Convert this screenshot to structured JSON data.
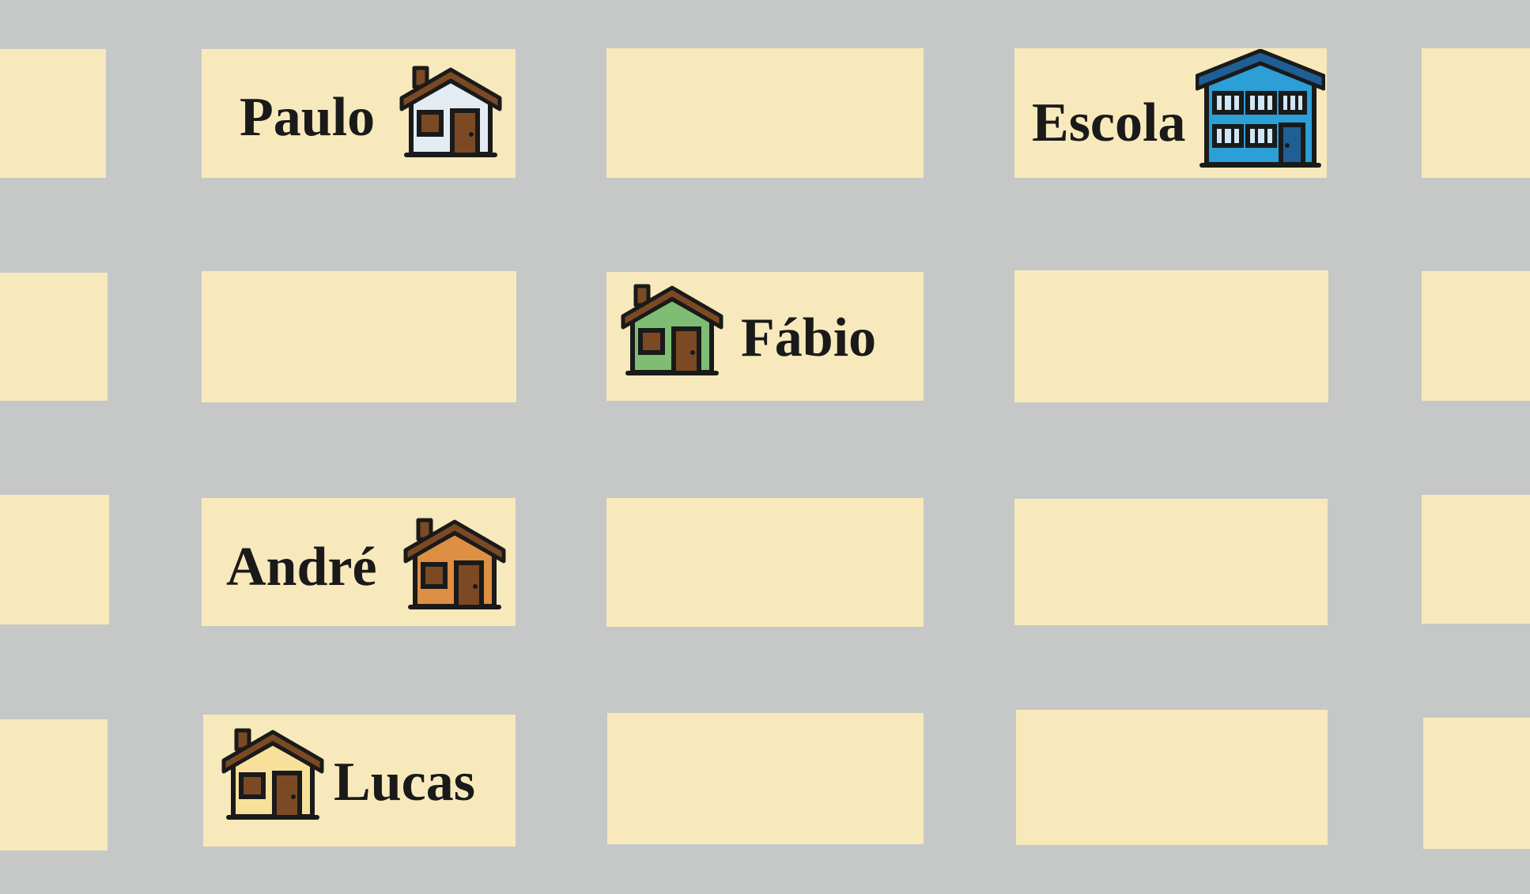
{
  "colors": {
    "street": "#c6c7c7",
    "block": "#f8e9bc",
    "roof": "#7b4a24",
    "outline": "#1a1a1a",
    "door": "#7b4a24",
    "house_paulo": "#e3ecf3",
    "house_fabio": "#7fbd74",
    "house_andre": "#dd8f43",
    "house_lucas": "#f7e19a",
    "school_wall": "#2b9fd6",
    "school_roof": "#1f5f95"
  },
  "places": {
    "paulo": {
      "label": "Paulo",
      "icon": "house-icon"
    },
    "escola": {
      "label": "Escola",
      "icon": "school-icon"
    },
    "fabio": {
      "label": "Fábio",
      "icon": "house-icon"
    },
    "andre": {
      "label": "André",
      "icon": "house-icon"
    },
    "lucas": {
      "label": "Lucas",
      "icon": "house-icon"
    }
  }
}
